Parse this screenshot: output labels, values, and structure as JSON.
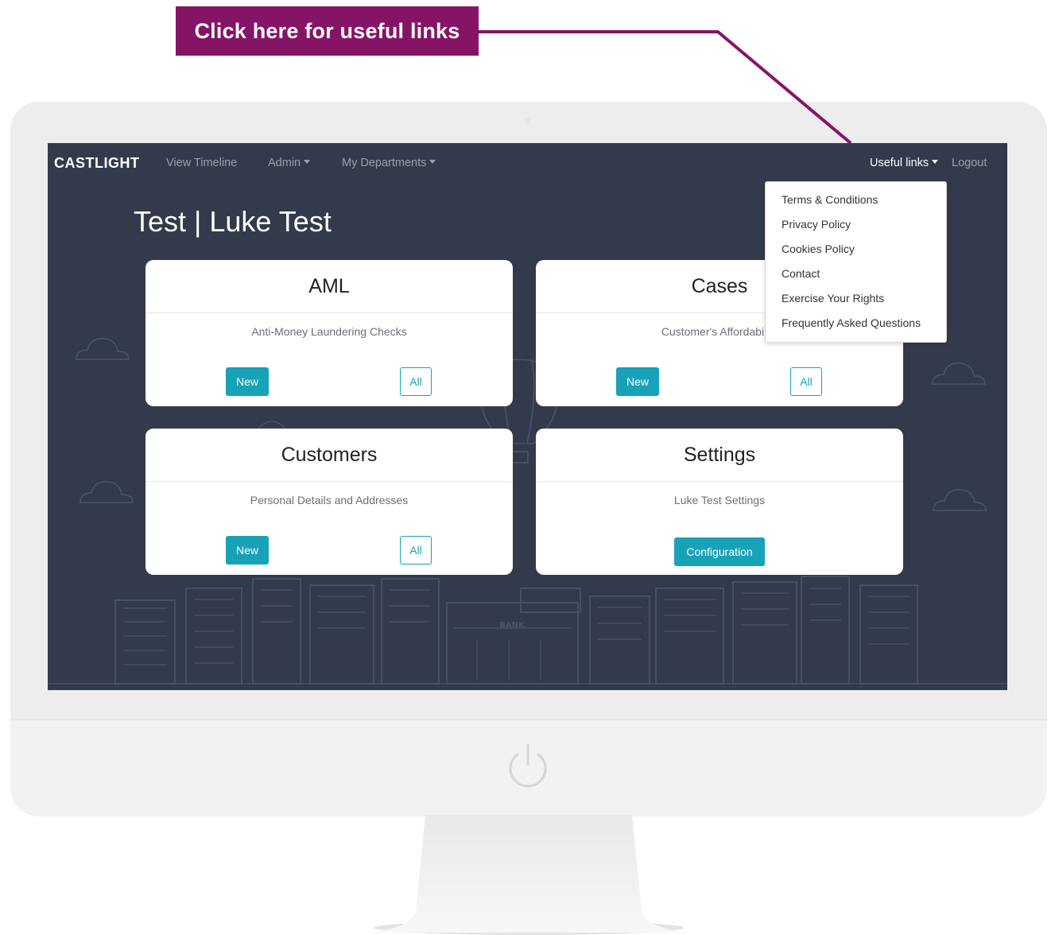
{
  "callout": {
    "text": "Click here for useful links",
    "color": "#861466"
  },
  "navbar": {
    "brand": "CASTLIGHT",
    "links": [
      {
        "label": "View Timeline"
      },
      {
        "label": "Admin"
      },
      {
        "label": "My Departments"
      }
    ],
    "useful_links": "Useful links",
    "logout": "Logout"
  },
  "page": {
    "title": "Test | Luke Test"
  },
  "cards": [
    {
      "title": "AML",
      "description": "Anti-Money Laundering Checks",
      "new_label": "New",
      "all_label": "All"
    },
    {
      "title": "Cases",
      "description": "Customer's Affordability",
      "new_label": "New",
      "all_label": "All"
    },
    {
      "title": "Customers",
      "description": "Personal Details and Addresses",
      "new_label": "New",
      "all_label": "All"
    },
    {
      "title": "Settings",
      "description": "Luke Test Settings",
      "config_label": "Configuration"
    }
  ],
  "dropdown": {
    "items": [
      "Terms & Conditions",
      "Privacy Policy",
      "Cookies Policy",
      "Contact",
      "Exercise Your Rights",
      "Frequently Asked Questions"
    ]
  },
  "skyline": {
    "bank_sign": "BANK"
  },
  "colors": {
    "screen_bg": "#333a4b",
    "accent": "#17a2b8",
    "callout": "#861466"
  }
}
